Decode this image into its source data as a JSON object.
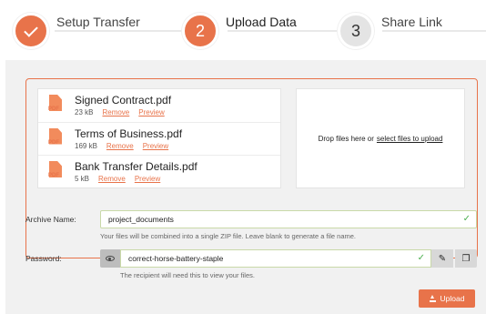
{
  "stepper": {
    "steps": [
      {
        "number": "",
        "label": "Setup Transfer",
        "state": "done"
      },
      {
        "number": "2",
        "label": "Upload Data",
        "state": "active"
      },
      {
        "number": "3",
        "label": "Share Link",
        "state": "pending"
      }
    ]
  },
  "files": [
    {
      "name": "Signed Contract.pdf",
      "size": "23 kB",
      "remove": "Remove",
      "preview": "Preview",
      "icon": "PDF"
    },
    {
      "name": "Terms of Business.pdf",
      "size": "169 kB",
      "remove": "Remove",
      "preview": "Preview",
      "icon": "PDF"
    },
    {
      "name": "Bank Transfer Details.pdf",
      "size": "5 kB",
      "remove": "Remove",
      "preview": "Preview",
      "icon": "PDF"
    }
  ],
  "dropzone": {
    "text": "Drop files here or",
    "link": "select files to upload"
  },
  "archive": {
    "label": "Archive Name:",
    "value": "project_documents",
    "help": "Your files will be combined into a single ZIP file. Leave blank to generate a file name."
  },
  "password": {
    "label": "Password:",
    "value": "correct-horse-battery-staple",
    "help": "The recipient will need this to view your files."
  },
  "actions": {
    "upload_label": "Upload"
  },
  "colors": {
    "accent": "#e8734a",
    "success": "#4caf50",
    "panel": "#f1f1f1"
  }
}
